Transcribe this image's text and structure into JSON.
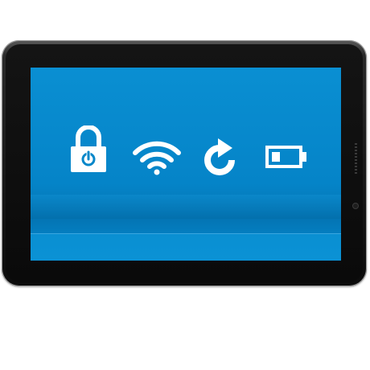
{
  "device": {
    "type": "tablet",
    "screen_color": "#0787c9",
    "frame_color": "#141414"
  },
  "status_icons": [
    {
      "name": "lock-power-icon",
      "color": "#ffffff"
    },
    {
      "name": "wifi-icon",
      "color": "#ffffff"
    },
    {
      "name": "refresh-icon",
      "color": "#ffffff"
    },
    {
      "name": "battery-icon",
      "color": "#ffffff",
      "level": 0.25
    }
  ]
}
